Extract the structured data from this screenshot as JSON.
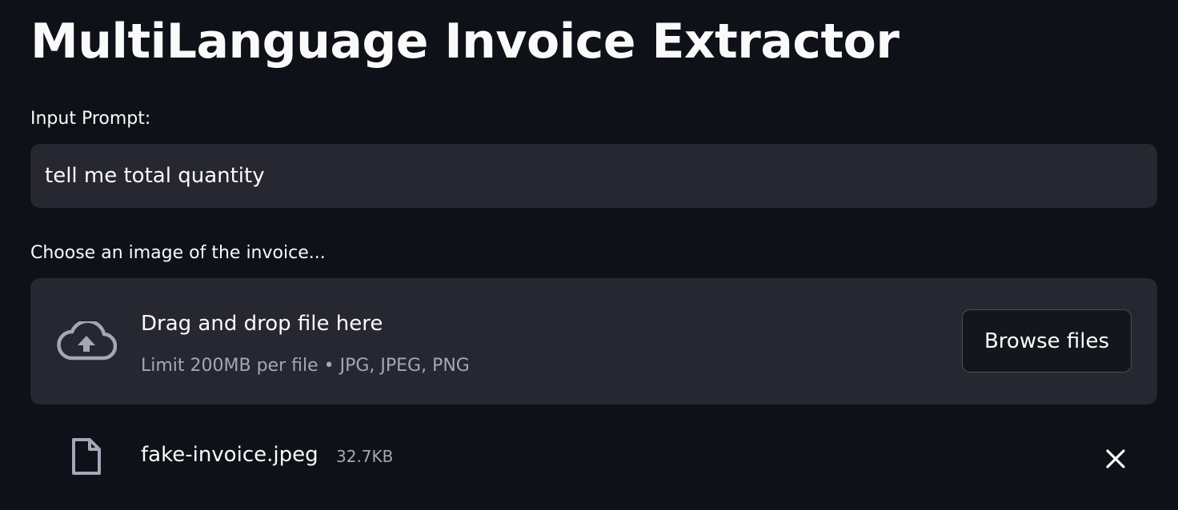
{
  "page": {
    "title": "MultiLanguage Invoice Extractor"
  },
  "prompt": {
    "label": "Input Prompt:",
    "value": "tell me total quantity"
  },
  "uploader": {
    "label": "Choose an image of the invoice...",
    "dropzone_title": "Drag and drop file here",
    "dropzone_subtitle": "Limit 200MB per file • JPG, JPEG, PNG",
    "browse_label": "Browse files",
    "icon": "cloud-upload-icon"
  },
  "uploaded_file": {
    "name": "fake-invoice.jpeg",
    "size": "32.7KB",
    "icon": "file-icon",
    "remove_icon": "close-icon"
  },
  "colors": {
    "background": "#0e1117",
    "surface": "#262730",
    "text": "#fafafa",
    "muted": "#a3a8b8"
  }
}
